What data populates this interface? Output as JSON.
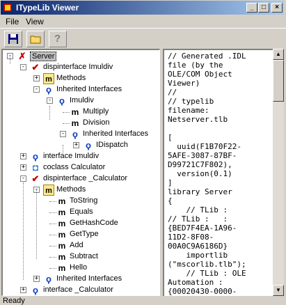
{
  "window": {
    "title": "ITypeLib Viewer"
  },
  "menu": [
    "File",
    "View"
  ],
  "tree": [
    {
      "label": "Server",
      "icon": "server-icon",
      "selected": true
    },
    {
      "label": "dispinterface Imuldiv",
      "icon": "dispinterface-icon"
    },
    {
      "label": "Methods",
      "icon": "methods-folder-icon"
    },
    {
      "label": "Inherited Interfaces",
      "icon": "interface-icon"
    },
    {
      "label": "Imuldiv",
      "icon": "interface-icon"
    },
    {
      "label": "Multiply",
      "icon": "method-icon"
    },
    {
      "label": "Division",
      "icon": "method-icon"
    },
    {
      "label": "Inherited Interfaces",
      "icon": "interface-icon"
    },
    {
      "label": "IDispatch",
      "icon": "interface-icon"
    },
    {
      "label": "interface Imuldiv",
      "icon": "interface-icon"
    },
    {
      "label": "coclass Calculator",
      "icon": "coclass-icon"
    },
    {
      "label": "dispinterface _Calculator",
      "icon": "dispinterface-icon"
    },
    {
      "label": "Methods",
      "icon": "methods-folder-icon"
    },
    {
      "label": "ToString",
      "icon": "method-icon"
    },
    {
      "label": "Equals",
      "icon": "method-icon"
    },
    {
      "label": "GetHashCode",
      "icon": "method-icon"
    },
    {
      "label": "GetType",
      "icon": "method-icon"
    },
    {
      "label": "Add",
      "icon": "method-icon"
    },
    {
      "label": "Subtract",
      "icon": "method-icon"
    },
    {
      "label": "Hello",
      "icon": "method-icon"
    },
    {
      "label": "Inherited Interfaces",
      "icon": "interface-icon"
    },
    {
      "label": "interface _Calculator",
      "icon": "interface-icon"
    }
  ],
  "code_text": "// Generated .IDL\nfile (by the\nOLE/COM Object\nViewer)\n//\n// typelib\nfilename:\nNetserver.tlb\n\n[\n  uuid(F1B70F22-\n5AFE-3087-87BF-\nD99721C7F802),\n  version(0.1)\n]\nlibrary Server\n{\n    // TLib :\n// TLib :   :\n{BED7F4EA-1A96-\n11D2-8F08-\n00A0C9A6186D}\n    importlib\n(\"mscorlib.tlb\");\n    // TLib : OLE\nAutomation :\n{00020430-0000-",
  "status": "Ready"
}
